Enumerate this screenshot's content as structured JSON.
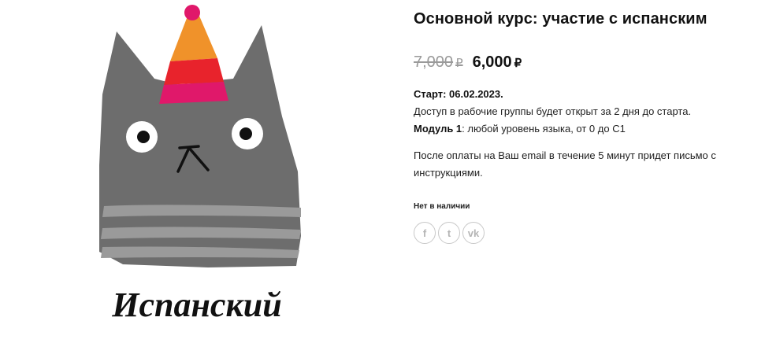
{
  "product": {
    "image_caption": "Испанский",
    "title": "Основной курс: участие с испанским",
    "old_price": "7,000",
    "new_price": "6,000",
    "currency": "₽",
    "start_label": "Старт: 06.02.2023.",
    "access_text": "Доступ в рабочие группы будет открыт за 2 дня до старта.",
    "module_label": "Модуль 1",
    "module_text": ": любой уровень языка, от 0 до С1",
    "payment_text": "После оплаты на Ваш email в течение 5 минут придет письмо с инструкциями.",
    "stock_status": "Нет в наличии"
  },
  "share": [
    {
      "icon": "facebook-icon",
      "glyph": "f"
    },
    {
      "icon": "twitter-icon",
      "glyph": "t"
    },
    {
      "icon": "vk-icon",
      "glyph": "vk"
    }
  ],
  "colors": {
    "cat_body": "#6d6d6d",
    "cat_stripes": "#9a9a9a",
    "hat_orange": "#f0922a",
    "hat_red": "#e8232c",
    "hat_pink": "#e0186a",
    "pompom": "#e0186a",
    "old_price": "#9a9a9a",
    "share_border": "#c8c8c8"
  }
}
